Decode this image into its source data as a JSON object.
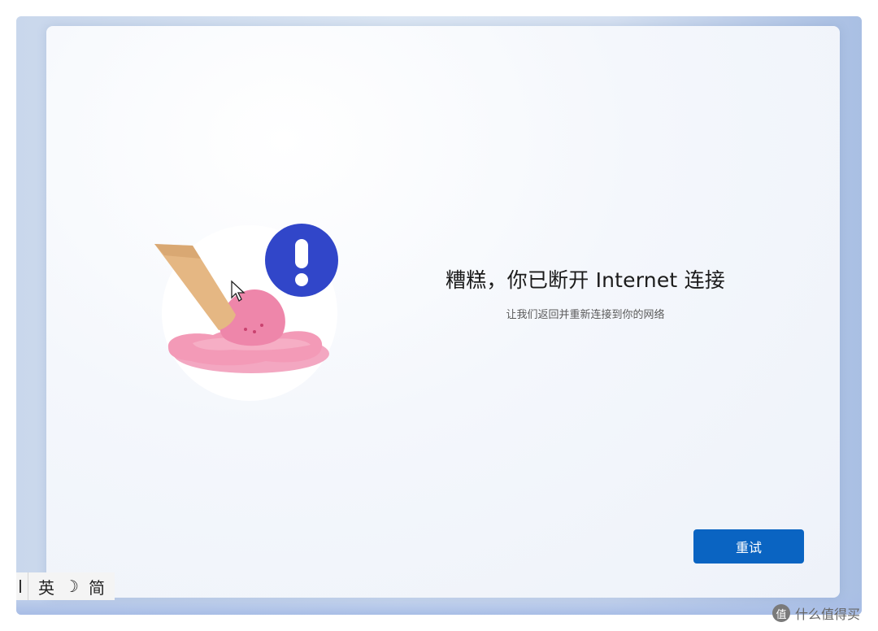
{
  "error": {
    "title": "糟糕，你已断开 Internet 连接",
    "subtitle": "让我们返回并重新连接到你的网络"
  },
  "actions": {
    "retry_label": "重试"
  },
  "ime_bar": {
    "mode": "英",
    "moon_glyph": "☽",
    "script": "简"
  },
  "watermark": {
    "logo_glyph": "值",
    "text": "什么值得买"
  },
  "colors": {
    "accent": "#0a64c2",
    "error_badge": "#3146c9",
    "ice_cream_pink": "#f28fb0",
    "cone": "#e3b886"
  },
  "icons": [
    "exclamation-icon",
    "melted-ice-cream-illustration",
    "mouse-cursor-icon",
    "moon-icon"
  ]
}
